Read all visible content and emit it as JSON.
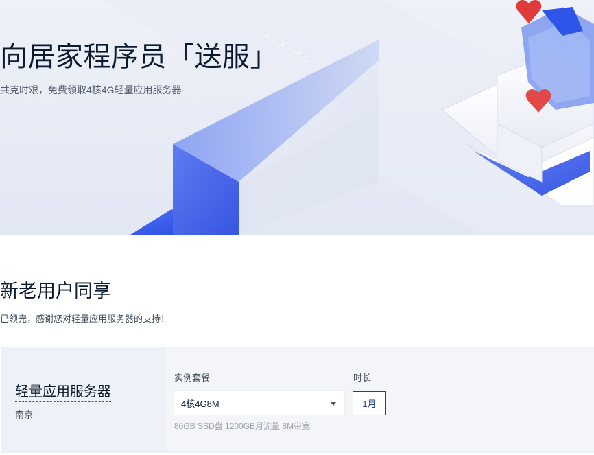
{
  "hero": {
    "title": "向居家程序员「送服」",
    "subtitle": "共克时艰，免费领取4核4G轻量应用服务器",
    "watermark": "风雪天下博客"
  },
  "section": {
    "title": "新老用户同享",
    "subtitle": "已领完，感谢您对轻量应用服务器的支持！"
  },
  "product": {
    "name": "轻量应用服务器",
    "region": "南京",
    "plan_label": "实例套餐",
    "plan_selected": "4核4G8M",
    "duration_label": "时长",
    "duration_selected": "1月",
    "spec": "80GB SSD盘 1200GB月流量 8M带宽"
  },
  "colors": {
    "accent": "#1e3f8a",
    "hero_blue": "#2f55e8"
  }
}
